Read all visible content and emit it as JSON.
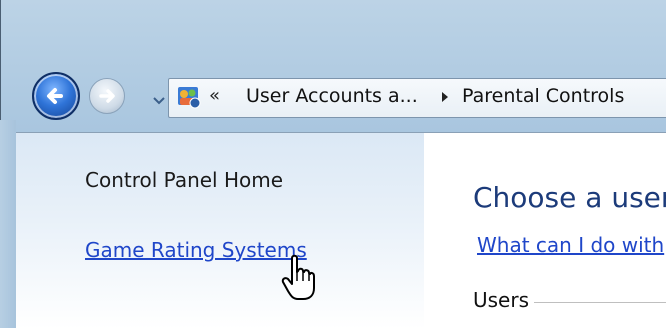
{
  "navigation": {
    "back_icon": "back-arrow-icon",
    "forward_icon": "forward-arrow-icon",
    "history_dropdown_icon": "chevron-down-icon"
  },
  "address_bar": {
    "location_icon": "control-panel-icon",
    "overflow_chevrons": "«",
    "crumb1": "User Accounts a...",
    "separator_icon": "chevron-right-icon",
    "crumb2": "Parental Controls"
  },
  "sidebar": {
    "home_label": "Control Panel Home",
    "links": [
      {
        "label": "Game Rating Systems"
      }
    ]
  },
  "main": {
    "title": "Choose a user",
    "help_link": "What can I do with",
    "users_section_label": "Users"
  },
  "colors": {
    "link": "#1f46c9",
    "title": "#1c3b7a",
    "sidebar_gradient_top": "#dbe8f5",
    "frame": "#a9c6df"
  }
}
